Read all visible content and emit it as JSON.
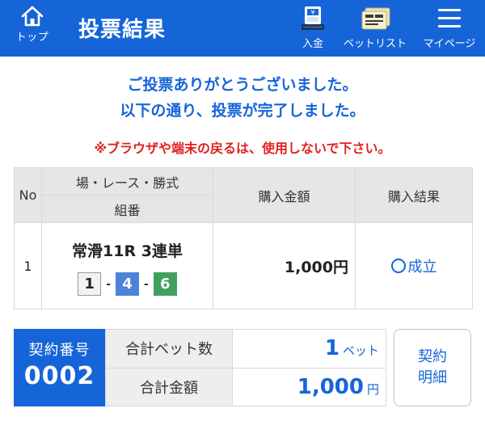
{
  "header": {
    "home_label": "トップ",
    "title": "投票結果",
    "nav": [
      {
        "label": "入金",
        "icon": "deposit-icon"
      },
      {
        "label": "ベットリスト",
        "icon": "ticket-list-icon"
      },
      {
        "label": "マイページ",
        "icon": "menu-icon"
      }
    ]
  },
  "messages": {
    "thanks_line1": "ご投票ありがとうございました。",
    "thanks_line2": "以下の通り、投票が完了しました。",
    "warning": "※ブラウザや端末の戻るは、使用しないで下さい。"
  },
  "table": {
    "headers": {
      "no": "No",
      "race": "場・レース・勝式",
      "combo": "組番",
      "amount": "購入金額",
      "result": "購入結果"
    },
    "rows": [
      {
        "no": "1",
        "race": "常滑11R 3連単",
        "combo": [
          "1",
          "4",
          "6"
        ],
        "combo_sep": "-",
        "amount": "1,000円",
        "result": "成立"
      }
    ]
  },
  "summary": {
    "contract_label": "契約番号",
    "contract_number": "0002",
    "total_bets_label": "合計ベット数",
    "total_bets_value": "1",
    "total_bets_unit": "ベット",
    "total_amount_label": "合計金額",
    "total_amount_value": "1,000",
    "total_amount_unit": "円",
    "detail_button_line1": "契約",
    "detail_button_line2": "明細"
  },
  "colors": {
    "brand_blue": "#1565d8",
    "warning_red": "#e0221e",
    "boat_1": "#f2f2f2",
    "boat_4": "#4d82d9",
    "boat_6": "#3fa060"
  }
}
